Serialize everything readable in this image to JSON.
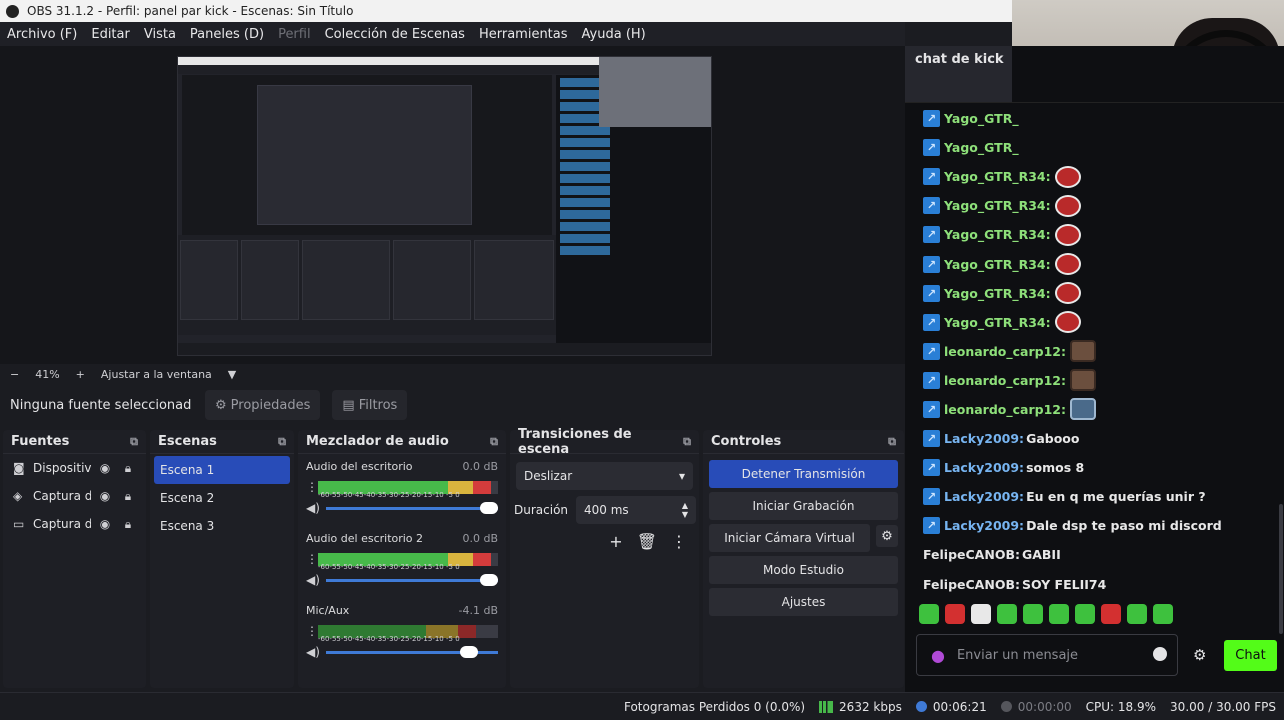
{
  "window": {
    "title": "OBS 31.1.2 - Perfil: panel par kick - Escenas: Sin Título"
  },
  "menu": [
    "Archivo (F)",
    "Editar",
    "Vista",
    "Paneles (D)",
    "Perfil",
    "Colección de Escenas",
    "Herramientas",
    "Ayuda (H)"
  ],
  "preview": {
    "zoom": "41%",
    "plus": "+",
    "minus": "−",
    "fit": "Ajustar a la ventana"
  },
  "source_bar": {
    "no_selection": "Ninguna fuente seleccionad",
    "properties": "Propiedades",
    "filters": "Filtros"
  },
  "sources": {
    "title": "Fuentes",
    "items": [
      {
        "name": "Dispositivo",
        "icon": "camera-icon"
      },
      {
        "name": "Captura de",
        "icon": "gamepad-icon"
      },
      {
        "name": "Captura de",
        "icon": "monitor-icon"
      }
    ]
  },
  "scenes": {
    "title": "Escenas",
    "items": [
      "Escena 1",
      "Escena 2",
      "Escena 3"
    ],
    "active": 0
  },
  "mixer": {
    "title": "Mezclador de audio",
    "ticks": "-60-55-50-45-40-35-30-25-20-15-10 -5 0",
    "channels": [
      {
        "name": "Audio del escritorio",
        "db": "0.0 dB",
        "level": 0.9
      },
      {
        "name": "Audio del escritorio 2",
        "db": "0.0 dB",
        "level": 0.9
      },
      {
        "name": "Mic/Aux",
        "db": "-4.1 dB",
        "level": 0.75
      }
    ]
  },
  "transitions": {
    "title": "Transiciones de escena",
    "selected": "Deslizar",
    "duration_label": "Duración",
    "duration": "400 ms"
  },
  "controls": {
    "title": "Controles",
    "stop_stream": "Detener Transmisión",
    "start_recording": "Iniciar Grabación",
    "start_virtual_cam": "Iniciar Cámara Virtual",
    "studio_mode": "Modo Estudio",
    "settings": "Ajustes"
  },
  "chat": {
    "title": "chat de kick",
    "messages": [
      {
        "user": "Yago_GTR_",
        "text": "",
        "emote": "",
        "color": "green"
      },
      {
        "user": "Yago_GTR_",
        "text": "",
        "emote": "",
        "color": "green"
      },
      {
        "user": "Yago_GTR_R34:",
        "text": "",
        "emote": "red",
        "color": "green"
      },
      {
        "user": "Yago_GTR_R34:",
        "text": "",
        "emote": "red",
        "color": "green"
      },
      {
        "user": "Yago_GTR_R34:",
        "text": "",
        "emote": "red",
        "color": "green"
      },
      {
        "user": "Yago_GTR_R34:",
        "text": "",
        "emote": "red",
        "color": "green"
      },
      {
        "user": "Yago_GTR_R34:",
        "text": "",
        "emote": "red",
        "color": "green"
      },
      {
        "user": "Yago_GTR_R34:",
        "text": "",
        "emote": "red",
        "color": "green"
      },
      {
        "user": "leonardo_carp12:",
        "text": "",
        "emote": "face",
        "color": "green"
      },
      {
        "user": "leonardo_carp12:",
        "text": "",
        "emote": "face",
        "color": "green"
      },
      {
        "user": "leonardo_carp12:",
        "text": "",
        "emote": "hat",
        "color": "green"
      },
      {
        "user": "Lacky2009:",
        "text": "Gabooo",
        "emote": "",
        "color": "blue"
      },
      {
        "user": "Lacky2009:",
        "text": "somos 8",
        "emote": "",
        "color": "blue"
      },
      {
        "user": "Lacky2009:",
        "text": "Eu en q me querías unir ?",
        "emote": "",
        "color": "blue"
      },
      {
        "user": "Lacky2009:",
        "text": "Dale dsp te paso mi discord",
        "emote": "",
        "color": "blue"
      },
      {
        "user": "FelipeCANOB:",
        "text": "GABII",
        "emote": "",
        "color": "white",
        "nobadge": true
      },
      {
        "user": "FelipeCANOB:",
        "text": "SOY FELII74",
        "emote": "",
        "color": "white",
        "nobadge": true
      }
    ],
    "input_placeholder": "Enviar un mensaje",
    "send": "Chat"
  },
  "status": {
    "dropped_frames": "Fotogramas Perdidos 0 (0.0%)",
    "bitrate": "2632 kbps",
    "stream_time": "00:06:21",
    "rec_time": "00:00:00",
    "cpu": "CPU: 18.9%",
    "fps": "30.00 / 30.00 FPS"
  },
  "colors": {
    "accent": "#284cb8",
    "kick_green": "#53fc18",
    "badge_blue": "#2a7fd6"
  }
}
